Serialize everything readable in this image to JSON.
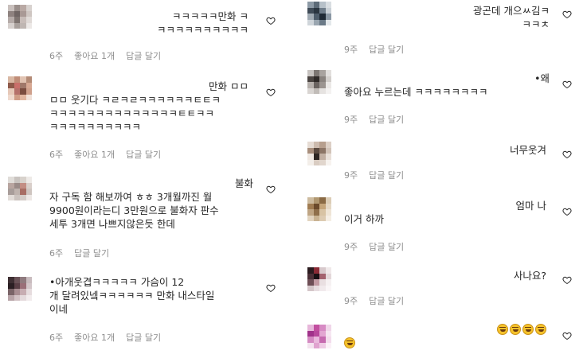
{
  "left_comments": [
    {
      "text": "ㅋㅋㅋㅋㅋ만화 ㅋ\nㅋㅋㅋㅋㅋㅋㅋㅋㅋㅋ",
      "time": "6주",
      "likes": "좋아요 1개",
      "reply": "답글 달기",
      "avatar": [
        "#c9c0bd",
        "#9a8f8b",
        "#b9a9a4",
        "#d8d2cf",
        "#8e827f",
        "#6f6563",
        "#a99995",
        "#cfc6c2",
        "#b5aba8",
        "#7e7470",
        "#c8bdb9",
        "#e0dad7",
        "#d6d0cd",
        "#a8a09c",
        "#bfb6b2",
        "#ece8e6"
      ]
    },
    {
      "text": "만화 ㅁㅁ\nㅁㅁ 웃기다 ㅋㄹㅋㄹㅋㅋㅋㅋㅋㅋㅌㅌㅋ\nㅋㅋㅋㅋㅋㅋㅋㅋㅋㅋㅋㅋㅋㅋㅌㅌㅋㅋ\nㅋㅋㅋㅋㅋㅋㅋㅋㅋㅋ",
      "time": "6주",
      "likes": "좋아요 1개",
      "reply": "답글 달기",
      "avatar": [
        "#d9b8a4",
        "#c08d78",
        "#e1c3b2",
        "#b48b76",
        "#8e5a4a",
        "#c96f6a",
        "#a0786a",
        "#d7a893",
        "#e6c8b8",
        "#b5706a",
        "#7a4c3f",
        "#cfa08c",
        "#efd9cd",
        "#cf9c86",
        "#e0b6a0",
        "#f1e2da"
      ]
    },
    {
      "text": "불화\n자 구독 함 해보까여 ㅎㅎ 3개월까진 월\n9900원이라는디 3만원으로 불화자 판수\n세투 3개면 나쁘지않은듯 한데",
      "time": "6주",
      "likes": "",
      "reply": "답글 달기",
      "avatar": [
        "#e0ddd9",
        "#c9c4c0",
        "#d8d2cc",
        "#eeeae7",
        "#b8a5a0",
        "#9a8b88",
        "#c38e84",
        "#d9cfca",
        "#a89d9a",
        "#bfb3ae",
        "#a86e64",
        "#cfc5c0",
        "#e2dcd8",
        "#cbc3bf",
        "#d4ccc7",
        "#ede8e5"
      ]
    },
    {
      "text": "•아개웃겹ㅋㅋㅋㅋㅋ 가슴이 12\n개 달려있넼ㅋㅋㅋㅋㅋㅋ 만화 내스타일\n이네",
      "time": "6주",
      "likes": "좋아요 1개",
      "reply": "답글 달기",
      "avatar": [
        "#3e2f33",
        "#6a5257",
        "#8f7a7e",
        "#c9bcbf",
        "#2b1f23",
        "#5a3f46",
        "#9a6f78",
        "#d3c6c9",
        "#7a6468",
        "#a88d92",
        "#c7adb2",
        "#e6dcde",
        "#b8a4a8",
        "#d2c2c5",
        "#e4dadc",
        "#f2eced"
      ]
    }
  ],
  "right_comments": [
    {
      "text": "광곤데 개으ㅆ김ㅋ\nㅋㅋㅊ",
      "time": "9주",
      "likes": "",
      "reply": "답글 달기",
      "avatar": [
        "#8d9aa6",
        "#5d6b78",
        "#b7c1c9",
        "#d9dee2",
        "#3f4b57",
        "#2a3540",
        "#6f7d8a",
        "#c9d0d6",
        "#a0aab3",
        "#4e5d6b",
        "#1f2a35",
        "#8b98a4",
        "#cfd5da",
        "#9aa6b0",
        "#6b7a87",
        "#e4e8eb"
      ]
    },
    {
      "text": "•왜\n좋아요 누르는데 ㅋㅋㅋㅋㅋㅋㅋㅋ",
      "time": "9주",
      "likes": "",
      "reply": "답글 달기",
      "avatar": [
        "#c7c3c0",
        "#7d7773",
        "#a9a39f",
        "#e2dfdd",
        "#4b4542",
        "#2f2a28",
        "#8a837f",
        "#d3cfcc",
        "#b6b0ac",
        "#6a6360",
        "#9c9591",
        "#ebe8e6",
        "#d9d5d2",
        "#c1bcb8",
        "#e6e3e1",
        "#f4f2f1"
      ]
    },
    {
      "text": "너무웃겨",
      "time": "9주",
      "likes": "",
      "reply": "답글 달기",
      "avatar": [
        "#e6dcd4",
        "#cdbbae",
        "#b79f8e",
        "#ddd0c6",
        "#a88e7c",
        "#5b4a40",
        "#8c7566",
        "#d2c3b8",
        "#efe7e1",
        "#2e2622",
        "#c2b0a3",
        "#e9e0d9",
        "#f3eee9",
        "#d9ccc2",
        "#e1d6cd",
        "#f7f3ef"
      ]
    },
    {
      "text": "엄마 나\n이거 하까",
      "time": "9주",
      "likes": "",
      "reply": "답글 달기",
      "avatar": [
        "#cdbb9f",
        "#b09770",
        "#8a6a44",
        "#dccdb6",
        "#a07c52",
        "#6b4a2b",
        "#c5a57a",
        "#e5d8c5",
        "#bfa584",
        "#8f6f4b",
        "#d8c3a4",
        "#efe5d6",
        "#e2d4c0",
        "#c9b393",
        "#ddcbb2",
        "#f5eee4"
      ]
    },
    {
      "text": "사나요?",
      "time": "9주",
      "likes": "",
      "reply": "답글 달기",
      "avatar": [
        "#2b1b1f",
        "#8a2a35",
        "#d8c9cc",
        "#f0e9ea",
        "#4a2f36",
        "#1a1014",
        "#a4636f",
        "#e4d8da",
        "#6e4e56",
        "#c29aa3",
        "#e9dfe1",
        "#f6f1f2",
        "#d4c6c9",
        "#e7dde0",
        "#f1eaec",
        "#faf6f7"
      ]
    },
    {
      "text": "EMOJI_LINE",
      "time": "",
      "likes": "",
      "reply": "",
      "avatar": [
        "#e7b7da",
        "#c24fa0",
        "#d78bc4",
        "#f0d6e9",
        "#a0328a",
        "#b8489c",
        "#e3a6d2",
        "#f6e6f1",
        "#d48ac2",
        "#e9b8dc",
        "#c66aaf",
        "#f3dcec",
        "#f4e2ef",
        "#e0a3cf",
        "#efcbe4",
        "#fbf1f7"
      ]
    }
  ],
  "emoji_line": {
    "first_line_count": 4,
    "second_line_count": 1,
    "name": "laughing-crying-emoji"
  }
}
